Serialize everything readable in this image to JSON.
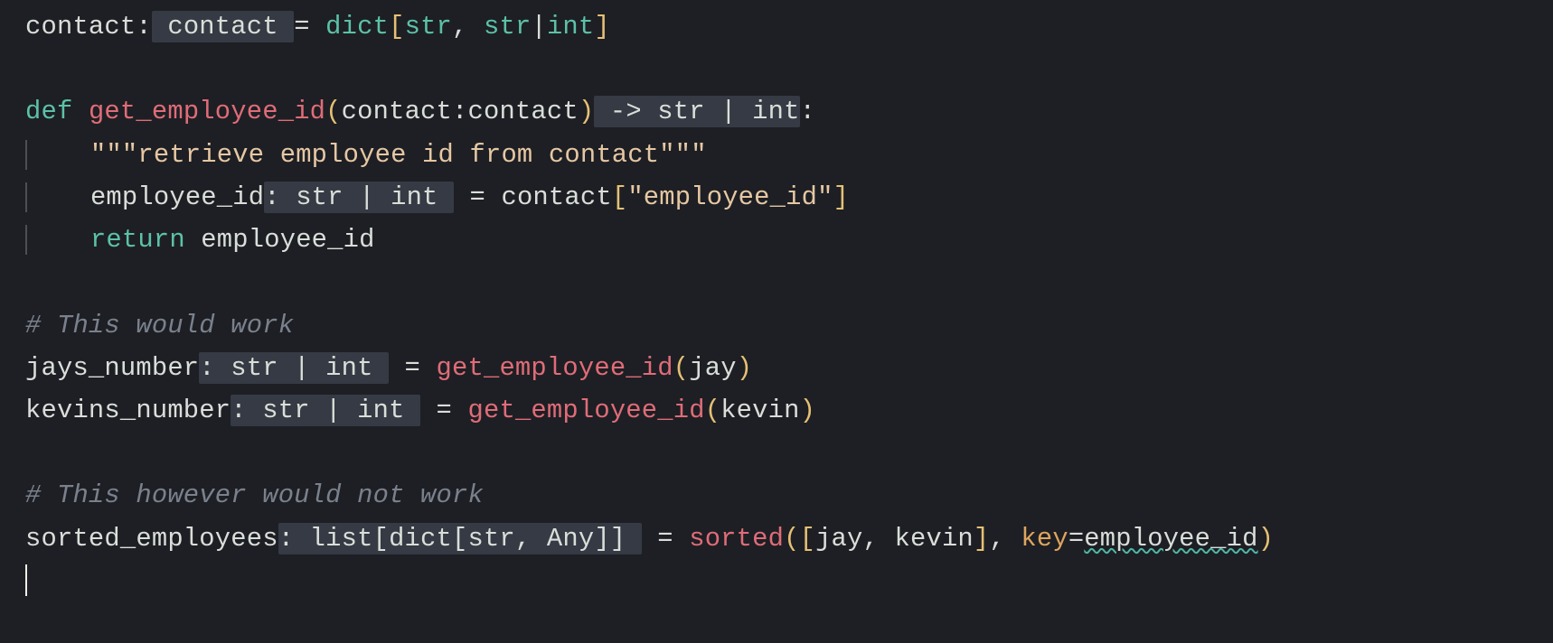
{
  "colors": {
    "bg": "#1d1f24",
    "fg": "#d9ded9",
    "keyword": "#5cc1a8",
    "func": "#e06c78",
    "bracket": "#e6c074",
    "string": "#e6c7a3",
    "comment": "#7a818c",
    "highlight_bg": "#353a44",
    "squiggle": "#4fb7a4"
  },
  "l1": {
    "contact1": "contact",
    "contact2": " contact ",
    "eq": "= ",
    "dict": "dict",
    "lb": "[",
    "str1": "str",
    "comma": ", ",
    "str2": "str",
    "pipe": "|",
    "int": "int",
    "rb": "]"
  },
  "l3": {
    "def": "def",
    "sp": " ",
    "fn": "get_employee_id",
    "lp": "(",
    "arg": "contact",
    "colon": ":",
    "argtype": "contact",
    "rp": ")",
    "ret": " -> str | int",
    "end": ":"
  },
  "l4": {
    "doc": "\"\"\"retrieve employee id from contact\"\"\""
  },
  "l5": {
    "name": "employee_id",
    "ann": ": str | int ",
    "eq": " = contact",
    "lb": "[",
    "lit": "\"employee_id\"",
    "rb": "]"
  },
  "l6": {
    "ret": "return",
    "var": " employee_id"
  },
  "l8": {
    "comment": "# This would work"
  },
  "l9": {
    "name": "jays_number",
    "ann": ": str | int ",
    "eq": " = ",
    "fn": "get_employee_id",
    "lp": "(",
    "arg": "jay",
    "rp": ")"
  },
  "l10": {
    "name": "kevins_number",
    "ann": ": str | int ",
    "eq": " = ",
    "fn": "get_employee_id",
    "lp": "(",
    "arg": "kevin",
    "rp": ")"
  },
  "l12": {
    "comment": "# This however would not work"
  },
  "l13": {
    "name": "sorted_employees",
    "ann": ": list[dict[str, Any]] ",
    "eq": " = ",
    "fn": "sorted",
    "lp": "(",
    "lb": "[",
    "a1": "jay",
    "comma1": ", ",
    "a2": "kevin",
    "rb": "]",
    "comma2": ", ",
    "kw": "key",
    "eqs": "=",
    "keyval": "employee_id",
    "rp": ")"
  }
}
